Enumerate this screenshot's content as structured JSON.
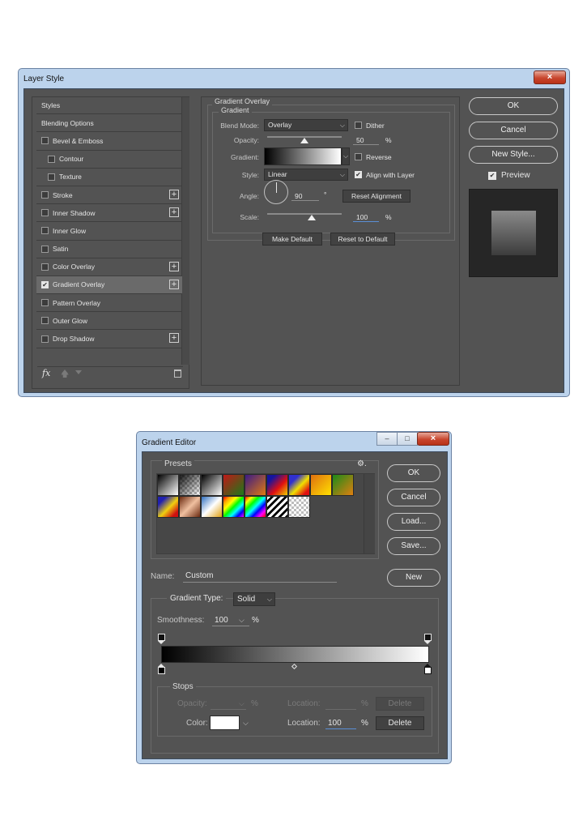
{
  "layer_style": {
    "title": "Layer Style",
    "close_symbol": "×",
    "styles": [
      {
        "label": "Styles",
        "checkbox": false,
        "indent": false,
        "plus": false
      },
      {
        "label": "Blending Options",
        "checkbox": false,
        "indent": false,
        "plus": false
      },
      {
        "label": "Bevel & Emboss",
        "checkbox": true,
        "checked": false,
        "indent": false,
        "plus": false
      },
      {
        "label": "Contour",
        "checkbox": true,
        "checked": false,
        "indent": true,
        "plus": false
      },
      {
        "label": "Texture",
        "checkbox": true,
        "checked": false,
        "indent": true,
        "plus": false
      },
      {
        "label": "Stroke",
        "checkbox": true,
        "checked": false,
        "indent": false,
        "plus": true
      },
      {
        "label": "Inner Shadow",
        "checkbox": true,
        "checked": false,
        "indent": false,
        "plus": true
      },
      {
        "label": "Inner Glow",
        "checkbox": true,
        "checked": false,
        "indent": false,
        "plus": false
      },
      {
        "label": "Satin",
        "checkbox": true,
        "checked": false,
        "indent": false,
        "plus": false
      },
      {
        "label": "Color Overlay",
        "checkbox": true,
        "checked": false,
        "indent": false,
        "plus": true
      },
      {
        "label": "Gradient Overlay",
        "checkbox": true,
        "checked": true,
        "indent": false,
        "plus": true,
        "selected": true
      },
      {
        "label": "Pattern Overlay",
        "checkbox": true,
        "checked": false,
        "indent": false,
        "plus": false
      },
      {
        "label": "Outer Glow",
        "checkbox": true,
        "checked": false,
        "indent": false,
        "plus": false
      },
      {
        "label": "Drop Shadow",
        "checkbox": true,
        "checked": false,
        "indent": false,
        "plus": true
      }
    ],
    "footer": {
      "fx": "fx",
      "up_icon": "arrow-up-icon",
      "down_icon": "arrow-down-icon",
      "trash_icon": "trash-icon"
    },
    "section_title": "Gradient Overlay",
    "subsection_title": "Gradient",
    "blend_mode_label": "Blend Mode:",
    "blend_mode_value": "Overlay",
    "dither_label": "Dither",
    "opacity_label": "Opacity:",
    "opacity_value": "50",
    "opacity_fraction": 0.5,
    "percent": "%",
    "gradient_label": "Gradient:",
    "reverse_label": "Reverse",
    "style_label": "Style:",
    "style_value": "Linear",
    "align_label": "Align with Layer",
    "angle_label": "Angle:",
    "angle_value": "90",
    "degree": "°",
    "reset_alignment": "Reset Alignment",
    "scale_label": "Scale:",
    "scale_value": "100",
    "scale_fraction": 0.6,
    "make_default": "Make Default",
    "reset_default": "Reset to Default",
    "ok": "OK",
    "cancel": "Cancel",
    "new_style": "New Style...",
    "preview_label": "Preview"
  },
  "gradient_editor": {
    "title": "Gradient Editor",
    "presets_label": "Presets",
    "gear_icon": "gear-icon",
    "ok": "OK",
    "cancel": "Cancel",
    "load": "Load...",
    "save": "Save...",
    "name_label": "Name:",
    "name_value": "Custom",
    "new": "New",
    "gradient_type_label": "Gradient Type:",
    "gradient_type_value": "Solid",
    "smoothness_label": "Smoothness:",
    "smoothness_value": "100",
    "percent": "%",
    "stops_label": "Stops",
    "opacity_label": "Opacity:",
    "location_label": "Location:",
    "delete": "Delete",
    "color_label": "Color:",
    "location_value": "100",
    "color_value": "#ffffff"
  }
}
